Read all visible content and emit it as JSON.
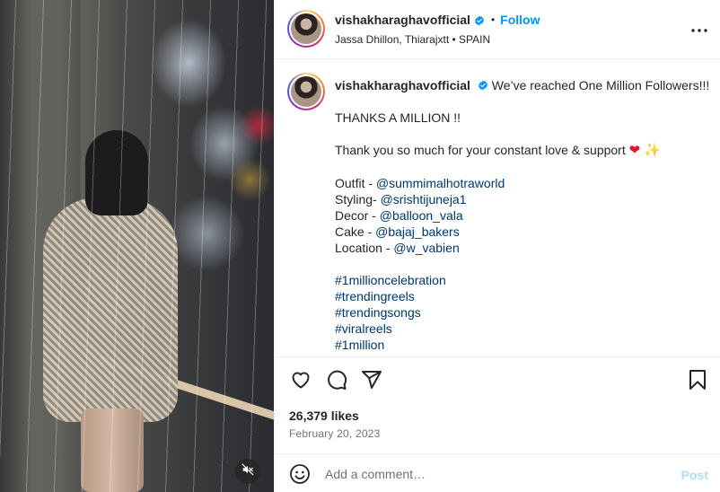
{
  "post": {
    "username": "vishakharaghavofficial",
    "follow_label": "Follow",
    "separator": "•",
    "location": "Jassa Dhillon, Thiarajxtt • SPAIN"
  },
  "caption": {
    "username": "vishakharaghavofficial",
    "headline": "We’ve reached One Million Followers!!!",
    "thanks": "THANKS A MILLION !!",
    "message": "Thank you so much for your constant love & support",
    "heart_emoji": "❤",
    "sparkle_emoji": "✨",
    "credits": [
      {
        "label": "Outfit - ",
        "handle": "@summimalhotraworld"
      },
      {
        "label": "Styling- ",
        "handle": "@srishtijuneja1"
      },
      {
        "label": "Decor - ",
        "handle": "@balloon_vala"
      },
      {
        "label": "Cake - ",
        "handle": "@bajaj_bakers"
      },
      {
        "label": "Location - ",
        "handle": "@w_vabien"
      }
    ],
    "hashtags": [
      "#1millioncelebration",
      "#trendingreels",
      "#trendingsongs",
      "#viralreels",
      "#1million"
    ]
  },
  "stats": {
    "likes": "26,379 likes",
    "date": "February 20, 2023"
  },
  "comment": {
    "placeholder": "Add a comment…",
    "post_label": "Post"
  },
  "icons": {
    "verified": "verified-badge-icon",
    "more": "more-options-icon",
    "like": "heart-icon",
    "comment": "comment-icon",
    "share": "share-icon",
    "save": "bookmark-icon",
    "mute": "muted-speaker-icon",
    "emoji": "emoji-icon"
  },
  "colors": {
    "link": "#00376b",
    "follow": "#0095f6",
    "post_disabled": "#b3dbff",
    "secondary_text": "#737373"
  }
}
